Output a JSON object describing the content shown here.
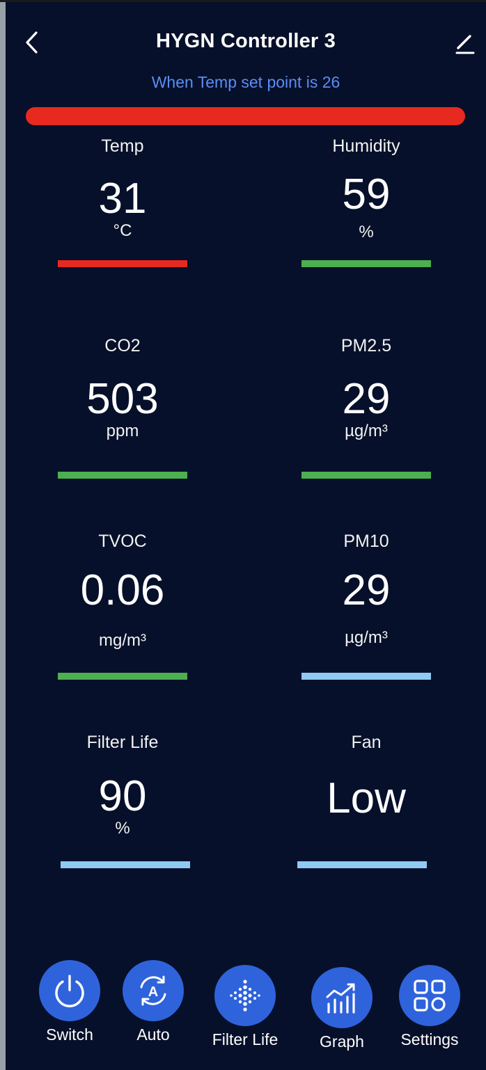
{
  "header": {
    "title": "HYGN Controller 3",
    "subtitle": "When Temp set point is 26",
    "back_icon": "chevron-left-icon",
    "edit_icon": "pencil-icon"
  },
  "status_bar": {
    "color": "#e8291f"
  },
  "metrics": [
    {
      "label": "Temp",
      "value": "31",
      "unit": "°C",
      "bar_color": "#e8291f"
    },
    {
      "label": "Humidity",
      "value": "59",
      "unit": "%",
      "bar_color": "#4caf50"
    },
    {
      "label": "CO2",
      "value": "503",
      "unit": "ppm",
      "bar_color": "#4caf50"
    },
    {
      "label": "PM2.5",
      "value": "29",
      "unit": "µg/m³",
      "bar_color": "#4caf50"
    },
    {
      "label": "TVOC",
      "value": "0.06",
      "unit": "mg/m³",
      "bar_color": "#4caf50"
    },
    {
      "label": "PM10",
      "value": "29",
      "unit": "µg/m³",
      "bar_color": "#8fcaf2"
    },
    {
      "label": "Filter Life",
      "value": "90",
      "unit": "%",
      "bar_color": "#8fcaf2"
    },
    {
      "label": "Fan",
      "value": "Low",
      "unit": "",
      "bar_color": "#8fcaf2"
    }
  ],
  "nav": [
    {
      "label": "Switch",
      "icon": "power-icon"
    },
    {
      "label": "Auto",
      "icon": "auto-mode-icon"
    },
    {
      "label": "Filter Life",
      "icon": "filter-icon"
    },
    {
      "label": "Graph",
      "icon": "chart-icon"
    },
    {
      "label": "Settings",
      "icon": "grid-apps-icon"
    }
  ],
  "colors": {
    "background": "#07102a",
    "accent": "#2f63db",
    "subtitle": "#5b8df5"
  }
}
